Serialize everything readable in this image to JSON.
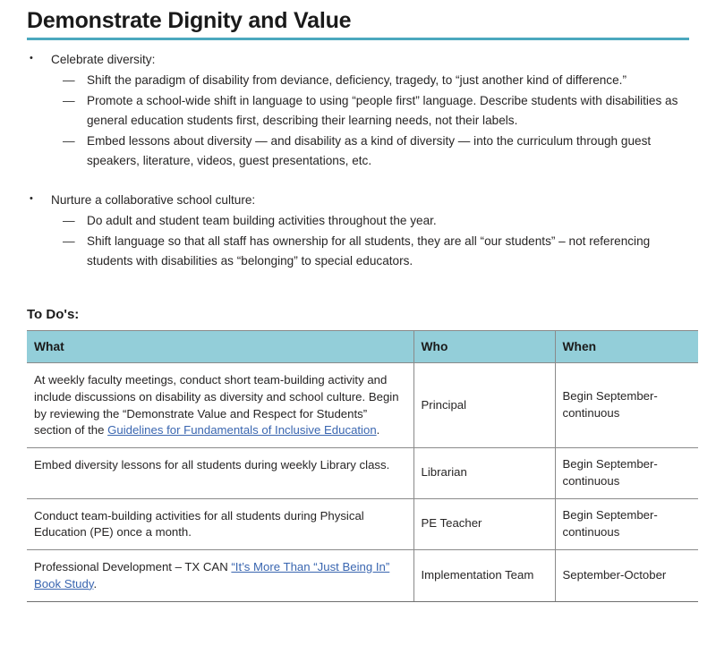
{
  "document": {
    "title": "Demonstrate Dignity and Value",
    "accent_color": "#4ba8be",
    "table_header_color": "#93ced9",
    "link_color": "#3a66b0"
  },
  "content": {
    "bullet_marker": "•",
    "dash_marker": "—",
    "groups": [
      {
        "heading": "Celebrate diversity:",
        "items": [
          "Shift the paradigm of disability from deviance, deficiency, tragedy, to “just another kind of difference.”",
          "Promote a school-wide shift in language to using “people first” language. Describe students with disabilities as general education students first,  describing their learning needs, not their labels.",
          "Embed lessons about diversity — and disability as a kind of diversity — into the curriculum through guest speakers, literature, videos, guest presentations, etc."
        ]
      },
      {
        "heading": "Nurture a collaborative school culture:",
        "items": [
          "Do adult and student team building activities throughout the year.",
          "Shift language so that all staff has ownership for all students, they are all “our students” – not referencing students with disabilities as “belonging” to special educators."
        ]
      }
    ]
  },
  "todo": {
    "heading": "To Do's:",
    "columns": [
      "What",
      "Who",
      "When"
    ],
    "rows": [
      {
        "what_before": "At weekly faculty meetings, conduct short team-building activity and include discussions on disability as diversity and school culture. Begin by reviewing the “Demonstrate Value and Respect for Students” section of the ",
        "what_link": "Guidelines for Fundamentals of Inclusive Education",
        "what_after": ".",
        "who": "Principal",
        "when": "Begin September-continuous"
      },
      {
        "what_before": "Embed diversity lessons for all students during weekly Library class.",
        "what_link": "",
        "what_after": "",
        "who": "Librarian",
        "when": "Begin September-continuous"
      },
      {
        "what_before": "Conduct team-building activities for all students during Physical Education (PE) once a month.",
        "what_link": "",
        "what_after": "",
        "who": "PE Teacher",
        "when": "Begin September-continuous"
      },
      {
        "what_before": "Professional Development – TX CAN ",
        "what_link": "“It’s More Than “Just Being In” Book Study",
        "what_after": ".",
        "who": "Implementation Team",
        "when": "September-October"
      }
    ]
  }
}
